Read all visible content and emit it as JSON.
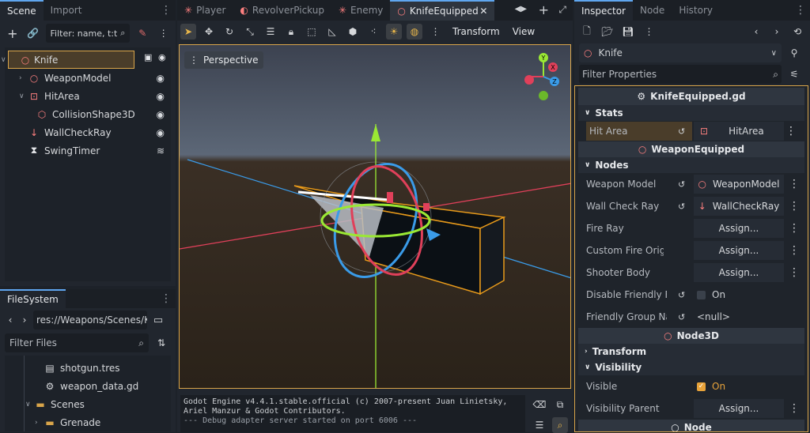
{
  "scene_panel": {
    "tabs": [
      "Scene",
      "Import"
    ],
    "filter_placeholder": "Filter: name, t:t",
    "tree": [
      {
        "label": "Knife",
        "depth": 0,
        "icon": "node3d-icon",
        "selected": true
      },
      {
        "label": "WeaponModel",
        "depth": 1,
        "icon": "node3d-icon"
      },
      {
        "label": "HitArea",
        "depth": 1,
        "icon": "area3d-icon"
      },
      {
        "label": "CollisionShape3D",
        "depth": 2,
        "icon": "collision-shape-icon"
      },
      {
        "label": "WallCheckRay",
        "depth": 1,
        "icon": "raycast-icon"
      },
      {
        "label": "SwingTimer",
        "depth": 1,
        "icon": "timer-icon"
      }
    ]
  },
  "filesystem": {
    "tab": "FileSystem",
    "path": "res://Weapons/Scenes/Kn",
    "filter_placeholder": "Filter Files",
    "items": [
      {
        "label": "shotgun.tres",
        "icon": "file-icon",
        "depth": 2
      },
      {
        "label": "weapon_data.gd",
        "icon": "gear-icon",
        "depth": 2
      },
      {
        "label": "Scenes",
        "icon": "folder-icon",
        "depth": 1
      },
      {
        "label": "Grenade",
        "icon": "folder-icon",
        "depth": 2
      }
    ]
  },
  "editor": {
    "tabs": [
      "Player",
      "RevolverPickup",
      "Enemy",
      "KnifeEquipped"
    ],
    "active_tab": "KnifeEquipped",
    "toolbar": {
      "transform": "Transform",
      "view": "View"
    },
    "viewport_label": "Perspective",
    "gizmo": {
      "y": "Y",
      "x": "X",
      "z": "Z"
    }
  },
  "output": {
    "lines": [
      "Godot Engine v4.4.1.stable.official (c) 2007-present Juan Linietsky,",
      "Ariel Manzur & Godot Contributors.",
      "--- Debug adapter server started on port 6006 ---"
    ]
  },
  "inspector": {
    "tabs": [
      "Inspector",
      "Node",
      "History"
    ],
    "node_name": "Knife",
    "filter_placeholder": "Filter Properties",
    "script_name": "KnifeEquipped.gd",
    "stats_section": "Stats",
    "hit_area": {
      "label": "Hit Area",
      "value": "HitArea"
    },
    "weapon_category": "WeaponEquipped",
    "nodes_section": "Nodes",
    "props": [
      {
        "label": "Weapon Model",
        "value": "WeaponModel",
        "revert": true
      },
      {
        "label": "Wall Check Ray",
        "value": "WallCheckRay",
        "revert": true
      },
      {
        "label": "Fire Ray",
        "value": "Assign...",
        "revert": false
      },
      {
        "label": "Custom Fire Origin",
        "value": "Assign...",
        "revert": false
      },
      {
        "label": "Shooter Body",
        "value": "Assign...",
        "revert": false
      }
    ],
    "disable_friendly_fire": {
      "label": "Disable Friendly Fire",
      "value": "On"
    },
    "friendly_group": {
      "label": "Friendly Group Nam",
      "value": "<null>"
    },
    "node3d_category": "Node3D",
    "transform_section": "Transform",
    "visibility_section": "Visibility",
    "visible": {
      "label": "Visible",
      "value": "On"
    },
    "visibility_parent": {
      "label": "Visibility Parent",
      "value": "Assign..."
    },
    "node_category": "Node"
  },
  "colors": {
    "accent": "#5fa6ef",
    "selection": "#4a3d2a",
    "highlight": "#d9a54a"
  }
}
